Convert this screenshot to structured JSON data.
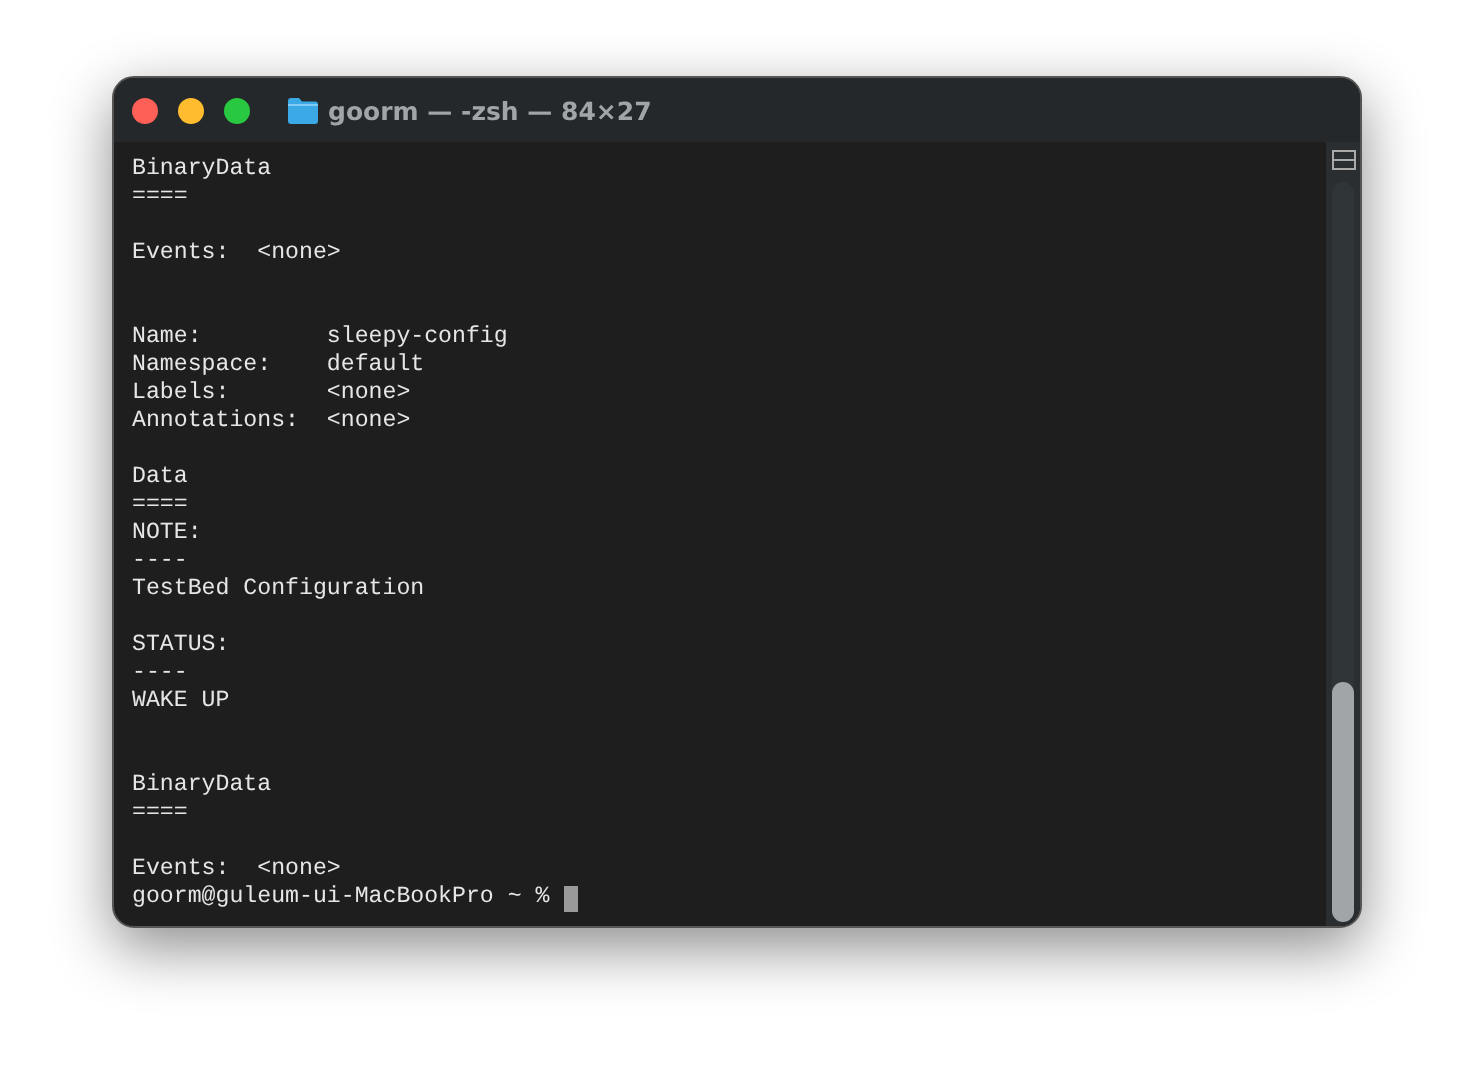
{
  "window": {
    "title": "goorm — -zsh — 84×27"
  },
  "terminal": {
    "lines": [
      {
        "kind": "text",
        "text": "BinaryData"
      },
      {
        "kind": "text",
        "text": "===="
      },
      {
        "kind": "blank"
      },
      {
        "kind": "text",
        "text": "Events:  <none>"
      },
      {
        "kind": "blank"
      },
      {
        "kind": "blank"
      },
      {
        "kind": "text",
        "text": "Name:         sleepy-config"
      },
      {
        "kind": "text",
        "text": "Namespace:    default"
      },
      {
        "kind": "text",
        "text": "Labels:       <none>"
      },
      {
        "kind": "text",
        "text": "Annotations:  <none>"
      },
      {
        "kind": "blank"
      },
      {
        "kind": "text",
        "text": "Data"
      },
      {
        "kind": "text",
        "text": "===="
      },
      {
        "kind": "text",
        "text": "NOTE:"
      },
      {
        "kind": "text",
        "text": "----"
      },
      {
        "kind": "text",
        "text": "TestBed Configuration"
      },
      {
        "kind": "blank"
      },
      {
        "kind": "text",
        "text": "STATUS:"
      },
      {
        "kind": "text",
        "text": "----"
      },
      {
        "kind": "text",
        "text": "WAKE UP"
      },
      {
        "kind": "blank"
      },
      {
        "kind": "blank"
      },
      {
        "kind": "text",
        "text": "BinaryData"
      },
      {
        "kind": "text",
        "text": "===="
      },
      {
        "kind": "blank"
      },
      {
        "kind": "text",
        "text": "Events:  <none>"
      },
      {
        "kind": "prompt",
        "text": "goorm@guleum-ui-MacBookPro ~ %"
      }
    ]
  }
}
